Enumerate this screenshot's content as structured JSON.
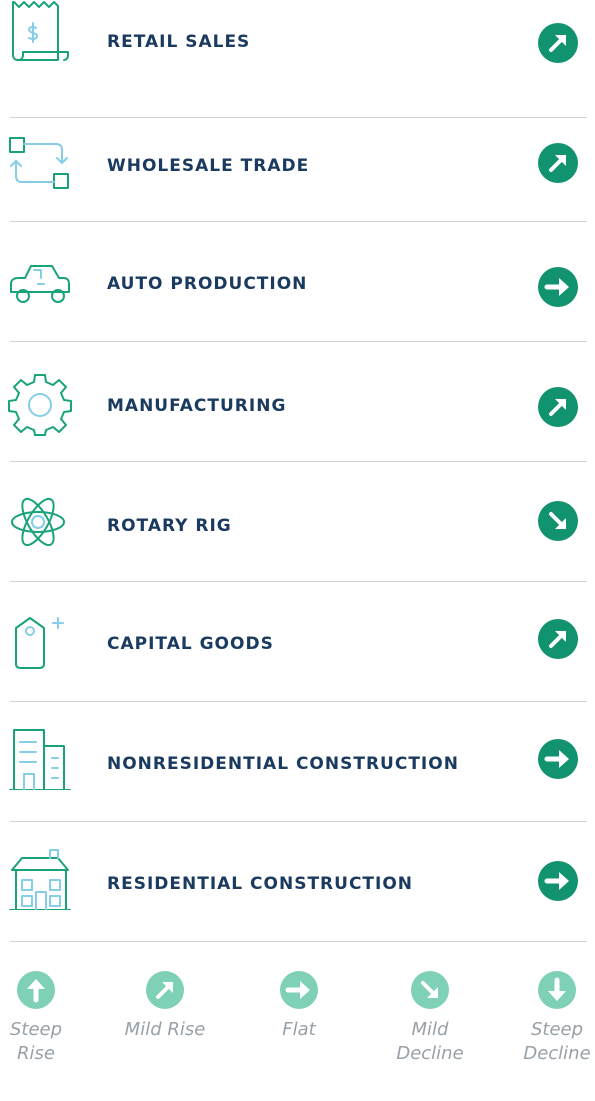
{
  "colors": {
    "trend_active": "#11936f",
    "trend_legend": "#7ed1b6",
    "icon_green": "#1aa37a",
    "icon_blue": "#86cde8",
    "label": "#1a3a5f",
    "legend_text": "#98a1a8"
  },
  "indicators": [
    {
      "label": "RETAIL SALES",
      "icon": "receipt-dollar-icon",
      "trend": "mild-rise"
    },
    {
      "label": "WHOLESALE TRADE",
      "icon": "exchange-arrows-icon",
      "trend": "mild-rise"
    },
    {
      "label": "AUTO PRODUCTION",
      "icon": "car-icon",
      "trend": "flat"
    },
    {
      "label": "MANUFACTURING",
      "icon": "gear-icon",
      "trend": "mild-rise"
    },
    {
      "label": "ROTARY RIG",
      "icon": "atom-icon",
      "trend": "mild-decline"
    },
    {
      "label": "CAPITAL GOODS",
      "icon": "price-tag-icon",
      "trend": "mild-rise"
    },
    {
      "label": "NONRESIDENTIAL CONSTRUCTION",
      "icon": "office-building-icon",
      "trend": "flat"
    },
    {
      "label": "RESIDENTIAL CONSTRUCTION",
      "icon": "house-icon",
      "trend": "flat"
    }
  ],
  "legend": [
    {
      "label": "Steep Rise",
      "trend": "steep-rise"
    },
    {
      "label": "Mild Rise",
      "trend": "mild-rise"
    },
    {
      "label": "Flat",
      "trend": "flat"
    },
    {
      "label": "Mild Decline",
      "trend": "mild-decline"
    },
    {
      "label": "Steep Decline",
      "trend": "steep-decline"
    }
  ]
}
